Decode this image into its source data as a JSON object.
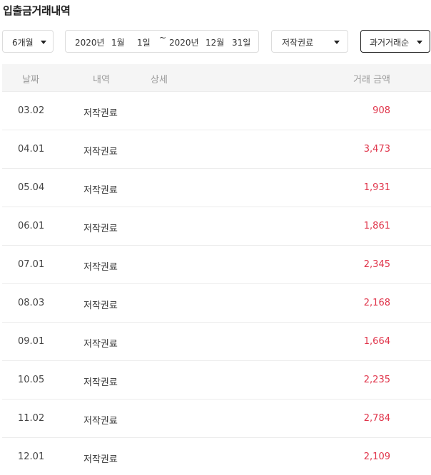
{
  "page_title": "입출금거래내역",
  "filters": {
    "period": {
      "selected": "6개월"
    },
    "date_range": {
      "start_year": "2020년",
      "start_month": "1월",
      "start_day": "1일",
      "separator": "~",
      "end_year": "2020년",
      "end_month": "12월",
      "end_day": "31일"
    },
    "category": {
      "selected": "저작권료"
    },
    "sort": {
      "selected": "과거거래순"
    }
  },
  "table": {
    "headers": {
      "date": "날짜",
      "item": "내역",
      "detail": "상세",
      "amount": "거래 금액"
    },
    "rows": [
      {
        "date": "03.02",
        "item": "저작권료",
        "detail": "",
        "amount": "908"
      },
      {
        "date": "04.01",
        "item": "저작권료",
        "detail": "",
        "amount": "3,473"
      },
      {
        "date": "05.04",
        "item": "저작권료",
        "detail": "",
        "amount": "1,931"
      },
      {
        "date": "06.01",
        "item": "저작권료",
        "detail": "",
        "amount": "1,861"
      },
      {
        "date": "07.01",
        "item": "저작권료",
        "detail": "",
        "amount": "2,345"
      },
      {
        "date": "08.03",
        "item": "저작권료",
        "detail": "",
        "amount": "2,168"
      },
      {
        "date": "09.01",
        "item": "저작권료",
        "detail": "",
        "amount": "1,664"
      },
      {
        "date": "10.05",
        "item": "저작권료",
        "detail": "",
        "amount": "2,235"
      },
      {
        "date": "11.02",
        "item": "저작권료",
        "detail": "",
        "amount": "2,784"
      },
      {
        "date": "12.01",
        "item": "저작권료",
        "detail": "",
        "amount": "2,109"
      }
    ]
  },
  "colors": {
    "amount_text": "#e0344a",
    "header_bg": "#f5f5f5",
    "border": "#dcdcdc"
  },
  "icons": {
    "dropdown": "caret-down-icon"
  }
}
